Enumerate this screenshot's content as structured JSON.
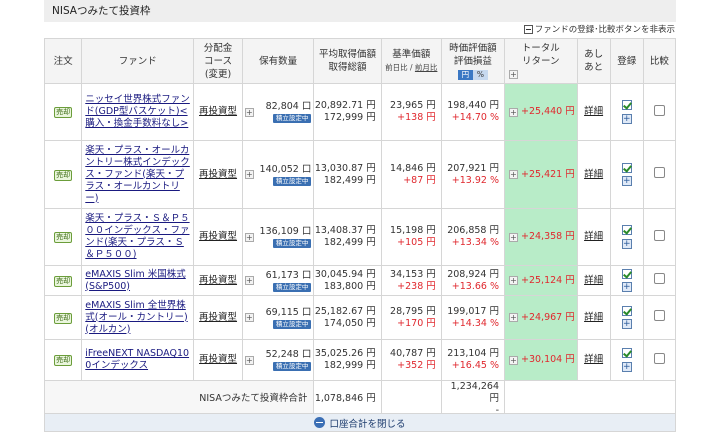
{
  "section": {
    "title": "NISAつみたて投資枠"
  },
  "toggle_link": {
    "label": "ファンドの登録･比較ボタンを非表示"
  },
  "headers": {
    "order": "注文",
    "fund": "ファンド",
    "course_l1": "分配金",
    "course_l2": "コース",
    "course_l3": "(変更)",
    "quantity": "保有数量",
    "avg_l1": "平均取得価額",
    "avg_l2": "取得総額",
    "base_l1": "基準価額",
    "base_prev": "前日比",
    "base_sep": "/",
    "base_prev2": "前月比",
    "eval_l1": "時価評価額",
    "eval_l2": "評価損益",
    "eval_toggle_yen": "円",
    "eval_toggle_pct": "%",
    "return_l1": "トータル",
    "return_l2": "リターン",
    "after_l1": "あし",
    "after_l2": "あと",
    "register": "登録",
    "compare": "比較"
  },
  "sell_badge": "売却",
  "tsumitate_label": "積立設定中",
  "detail_label": "詳細",
  "rows": [
    {
      "fund": "ニッセイ世界株式ファンド(GDP型バスケット)<購入・換金手数料なし>",
      "course": "再投資型",
      "quantity": "82,804 口",
      "avg_price": "20,892.71 円",
      "avg_total": "172,999 円",
      "base_price": "23,965 円",
      "base_change": "+138 円",
      "eval_value": "198,440 円",
      "eval_pct": "+14.70 %",
      "total_return": "+25,440 円"
    },
    {
      "fund": "楽天・プラス・オールカントリー株式インデックス・ファンド(楽天・プラス・オールカントリー)",
      "course": "再投資型",
      "quantity": "140,052 口",
      "avg_price": "13,030.87 円",
      "avg_total": "182,499 円",
      "base_price": "14,846 円",
      "base_change": "+87 円",
      "eval_value": "207,921 円",
      "eval_pct": "+13.92 %",
      "total_return": "+25,421 円"
    },
    {
      "fund": "楽天・プラス・Ｓ＆Ｐ５００インデックス・ファンド(楽天・プラス・Ｓ＆Ｐ５００)",
      "course": "再投資型",
      "quantity": "136,109 口",
      "avg_price": "13,408.37 円",
      "avg_total": "182,499 円",
      "base_price": "15,198 円",
      "base_change": "+105 円",
      "eval_value": "206,858 円",
      "eval_pct": "+13.34 %",
      "total_return": "+24,358 円"
    },
    {
      "fund": "eMAXIS Slim 米国株式(S&P500)",
      "course": "再投資型",
      "quantity": "61,173 口",
      "avg_price": "30,045.94 円",
      "avg_total": "183,800 円",
      "base_price": "34,153 円",
      "base_change": "+238 円",
      "eval_value": "208,924 円",
      "eval_pct": "+13.66 %",
      "total_return": "+25,124 円"
    },
    {
      "fund": "eMAXIS Slim 全世界株式(オール・カントリー)(オルカン)",
      "course": "再投資型",
      "quantity": "69,115 口",
      "avg_price": "25,182.67 円",
      "avg_total": "174,050 円",
      "base_price": "28,795 円",
      "base_change": "+170 円",
      "eval_value": "199,017 円",
      "eval_pct": "+14.34 %",
      "total_return": "+24,967 円"
    },
    {
      "fund": "iFreeNEXT NASDAQ100インデックス",
      "course": "再投資型",
      "quantity": "52,248 口",
      "avg_price": "35,025.26 円",
      "avg_total": "182,999 円",
      "base_price": "40,787 円",
      "base_change": "+352 円",
      "eval_value": "213,104 円",
      "eval_pct": "+16.45 %",
      "total_return": "+30,104 円"
    }
  ],
  "totals": {
    "label": "NISAつみたて投資枠合計",
    "acquisition_total": "1,078,846 円",
    "eval_total": "1,234,264 円",
    "eval_dash": "-"
  },
  "close_button": {
    "label": "口座合計を閉じる"
  },
  "colors": {
    "gain": "#e0282e",
    "return_highlight": "#b8ecc8",
    "link": "#1a1a80",
    "accent": "#3b78c4"
  }
}
